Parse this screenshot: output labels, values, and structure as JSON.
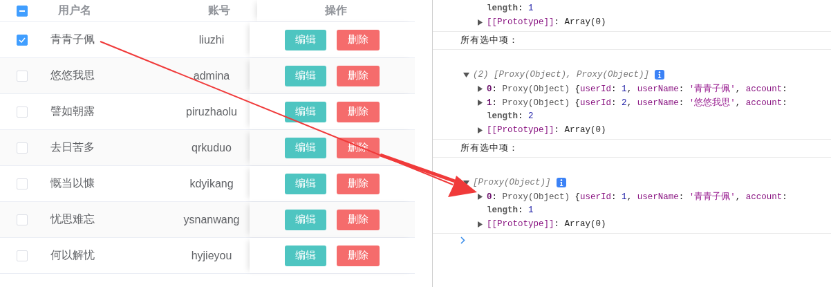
{
  "table": {
    "header": {
      "select_all": {
        "indeterminate": true
      },
      "columns": [
        "用户名",
        "账号",
        "操作"
      ]
    },
    "rows": [
      {
        "checked": true,
        "name": "青青子佩",
        "account": "liuzhi",
        "actions": [
          "编辑",
          "删除"
        ]
      },
      {
        "checked": false,
        "name": "悠悠我思",
        "account": "admina",
        "actions": [
          "编辑",
          "删除"
        ]
      },
      {
        "checked": false,
        "name": "譬如朝露",
        "account": "piruzhaolu",
        "actions": [
          "编辑",
          "删除"
        ]
      },
      {
        "checked": false,
        "name": "去日苦多",
        "account": "qrkuduo",
        "actions": [
          "编辑",
          "删除"
        ]
      },
      {
        "checked": false,
        "name": "慨当以慷",
        "account": "kdyikang",
        "actions": [
          "编辑",
          "删除"
        ]
      },
      {
        "checked": false,
        "name": "忧思难忘",
        "account": "ysnanwang",
        "actions": [
          "编辑",
          "删除"
        ]
      },
      {
        "checked": false,
        "name": "何以解忧",
        "account": "hyjieyou",
        "actions": [
          "编辑",
          "删除"
        ]
      }
    ]
  },
  "console": {
    "entries": [
      {
        "kind": "tail",
        "children": [
          {
            "tokens": [
              {
                "t": "length",
                "kind": "key"
              },
              {
                "t": ": ",
                "kind": "plain"
              },
              {
                "t": "1",
                "kind": "number"
              }
            ]
          },
          {
            "expanded": false,
            "tokens": [
              {
                "t": "[[Prototype]]",
                "kind": "prop"
              },
              {
                "t": ": ",
                "kind": "plain"
              },
              {
                "t": "Array(0)",
                "kind": "plain"
              }
            ]
          }
        ]
      },
      {
        "kind": "log",
        "text": "所有选中项："
      },
      {
        "kind": "object",
        "summary": "(2) [Proxy(Object), Proxy(Object)]",
        "expanded": true,
        "children": [
          {
            "expanded": false,
            "tokens": [
              {
                "t": "0",
                "kind": "index"
              },
              {
                "t": ": ",
                "kind": "plain"
              },
              {
                "t": "Proxy(Object) ",
                "kind": "type"
              },
              {
                "t": "{",
                "kind": "plain"
              },
              {
                "t": "userId",
                "kind": "prop"
              },
              {
                "t": ": ",
                "kind": "plain"
              },
              {
                "t": "1",
                "kind": "number"
              },
              {
                "t": ", ",
                "kind": "plain"
              },
              {
                "t": "userName",
                "kind": "prop"
              },
              {
                "t": ": ",
                "kind": "plain"
              },
              {
                "t": "'青青子佩'",
                "kind": "string"
              },
              {
                "t": ", ",
                "kind": "plain"
              },
              {
                "t": "account",
                "kind": "prop"
              },
              {
                "t": ":",
                "kind": "plain"
              }
            ]
          },
          {
            "expanded": false,
            "tokens": [
              {
                "t": "1",
                "kind": "index"
              },
              {
                "t": ": ",
                "kind": "plain"
              },
              {
                "t": "Proxy(Object) ",
                "kind": "type"
              },
              {
                "t": "{",
                "kind": "plain"
              },
              {
                "t": "userId",
                "kind": "prop"
              },
              {
                "t": ": ",
                "kind": "plain"
              },
              {
                "t": "2",
                "kind": "number"
              },
              {
                "t": ", ",
                "kind": "plain"
              },
              {
                "t": "userName",
                "kind": "prop"
              },
              {
                "t": ": ",
                "kind": "plain"
              },
              {
                "t": "'悠悠我思'",
                "kind": "string"
              },
              {
                "t": ", ",
                "kind": "plain"
              },
              {
                "t": "account",
                "kind": "prop"
              },
              {
                "t": ":",
                "kind": "plain"
              }
            ]
          },
          {
            "tokens": [
              {
                "t": "length",
                "kind": "key"
              },
              {
                "t": ": ",
                "kind": "plain"
              },
              {
                "t": "2",
                "kind": "number"
              }
            ]
          },
          {
            "expanded": false,
            "tokens": [
              {
                "t": "[[Prototype]]",
                "kind": "prop"
              },
              {
                "t": ": ",
                "kind": "plain"
              },
              {
                "t": "Array(0)",
                "kind": "plain"
              }
            ]
          }
        ]
      },
      {
        "kind": "log",
        "text": "所有选中项："
      },
      {
        "kind": "object",
        "summary": "[Proxy(Object)]",
        "expanded": true,
        "children": [
          {
            "expanded": false,
            "tokens": [
              {
                "t": "0",
                "kind": "index"
              },
              {
                "t": ": ",
                "kind": "plain"
              },
              {
                "t": "Proxy(Object) ",
                "kind": "type"
              },
              {
                "t": "{",
                "kind": "plain"
              },
              {
                "t": "userId",
                "kind": "prop"
              },
              {
                "t": ": ",
                "kind": "plain"
              },
              {
                "t": "1",
                "kind": "number"
              },
              {
                "t": ", ",
                "kind": "plain"
              },
              {
                "t": "userName",
                "kind": "prop"
              },
              {
                "t": ": ",
                "kind": "plain"
              },
              {
                "t": "'青青子佩'",
                "kind": "string"
              },
              {
                "t": ", ",
                "kind": "plain"
              },
              {
                "t": "account",
                "kind": "prop"
              },
              {
                "t": ":",
                "kind": "plain"
              }
            ]
          },
          {
            "tokens": [
              {
                "t": "length",
                "kind": "key"
              },
              {
                "t": ": ",
                "kind": "plain"
              },
              {
                "t": "1",
                "kind": "number"
              }
            ]
          },
          {
            "expanded": false,
            "tokens": [
              {
                "t": "[[Prototype]]",
                "kind": "prop"
              },
              {
                "t": ": ",
                "kind": "plain"
              },
              {
                "t": "Array(0)",
                "kind": "plain"
              }
            ]
          }
        ]
      }
    ]
  }
}
